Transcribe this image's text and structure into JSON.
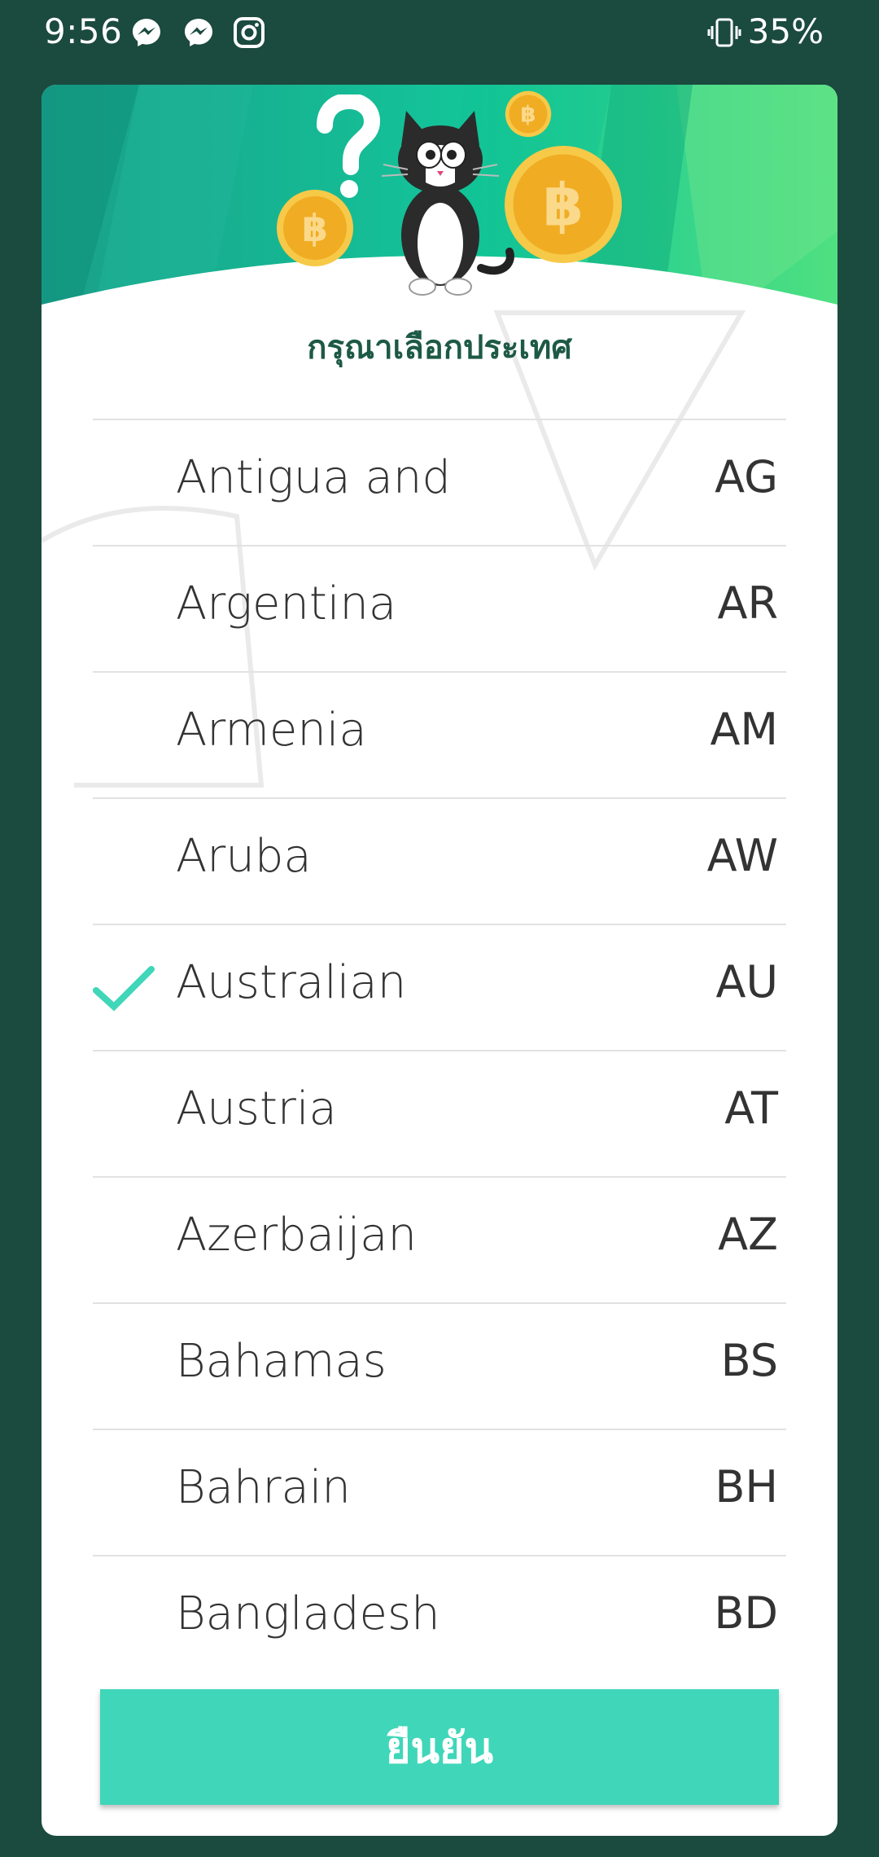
{
  "status_bar": {
    "time": "9:56",
    "battery": "35%",
    "notification_icons": [
      "messenger-icon",
      "messenger-icon",
      "instagram-icon"
    ]
  },
  "dialog": {
    "title": "กรุณาเลือกประเทศ",
    "confirm_label": "ยืนยัน",
    "countries": [
      {
        "name": "Antigua and",
        "code": "AG",
        "selected": false
      },
      {
        "name": "Argentina",
        "code": "AR",
        "selected": false
      },
      {
        "name": "Armenia",
        "code": "AM",
        "selected": false
      },
      {
        "name": "Aruba",
        "code": "AW",
        "selected": false
      },
      {
        "name": "Australian",
        "code": "AU",
        "selected": true
      },
      {
        "name": "Austria",
        "code": "AT",
        "selected": false
      },
      {
        "name": "Azerbaijan",
        "code": "AZ",
        "selected": false
      },
      {
        "name": "Bahamas",
        "code": "BS",
        "selected": false
      },
      {
        "name": "Bahrain",
        "code": "BH",
        "selected": false
      },
      {
        "name": "Bangladesh",
        "code": "BD",
        "selected": false
      }
    ]
  },
  "colors": {
    "background": "#1b4a3f",
    "accent": "#40d6b9",
    "title": "#1d5a45",
    "coin": "#f0ac23"
  }
}
